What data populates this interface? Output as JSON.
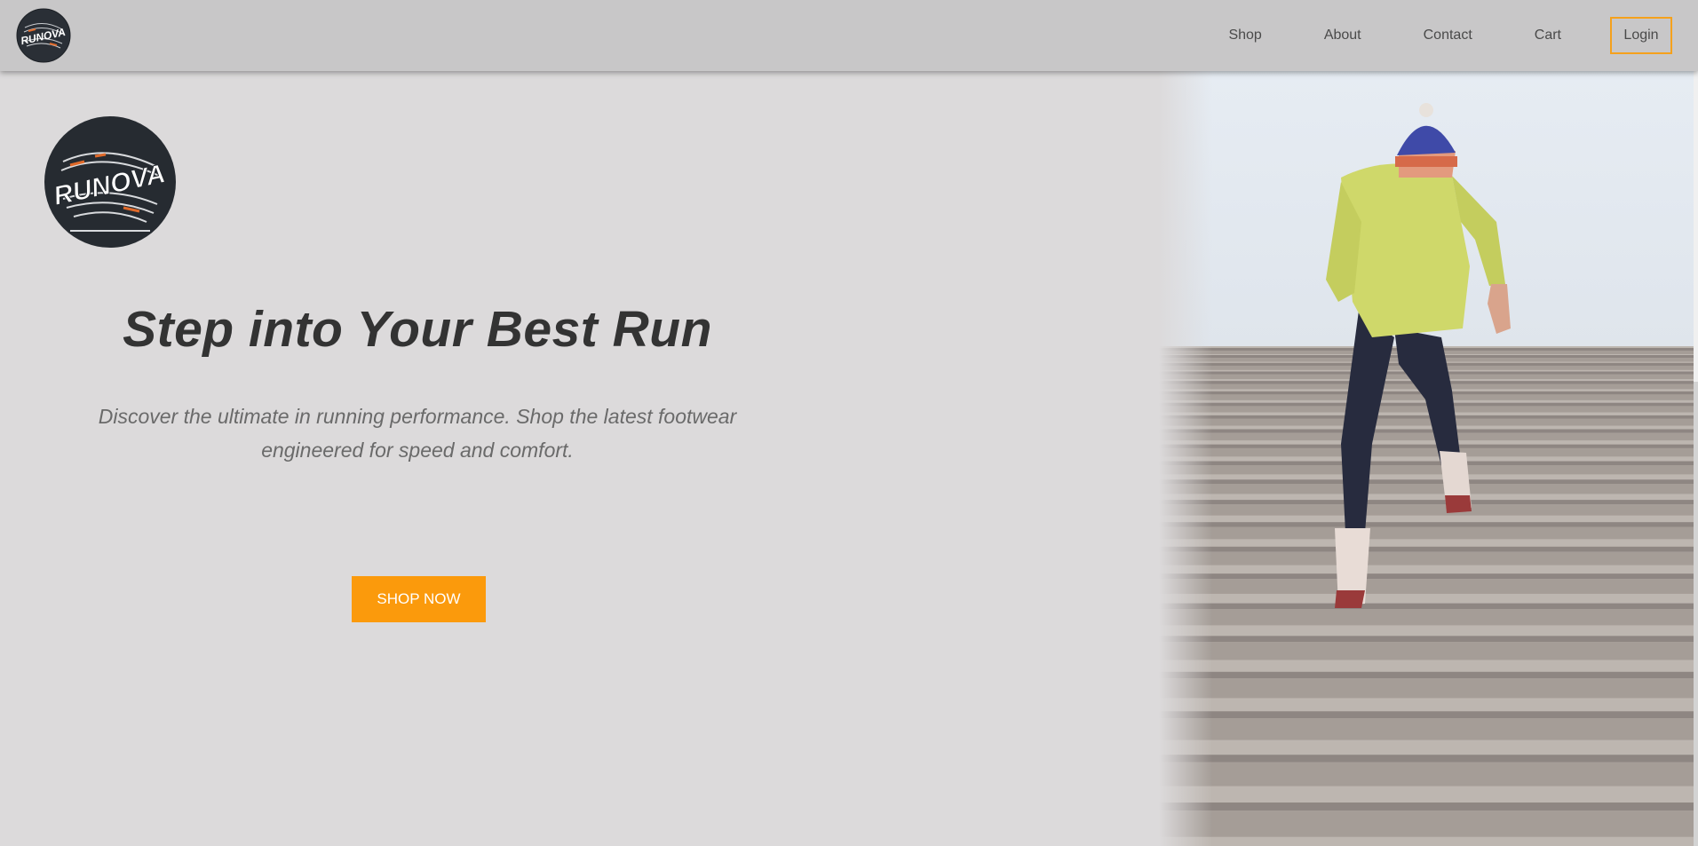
{
  "brand": {
    "name": "RUNOVA",
    "accent_color": "#fb9a0c"
  },
  "nav": {
    "items": [
      {
        "label": "Shop"
      },
      {
        "label": "About"
      },
      {
        "label": "Contact"
      },
      {
        "label": "Cart"
      }
    ],
    "login_label": "Login"
  },
  "hero": {
    "title": "Step into Your Best Run",
    "subtitle": "Discover the ultimate in running performance. Shop the latest footwear engineered for speed and comfort.",
    "cta_label": "SHOP NOW",
    "image_alt": "runner-climbing-stairs-photo"
  }
}
